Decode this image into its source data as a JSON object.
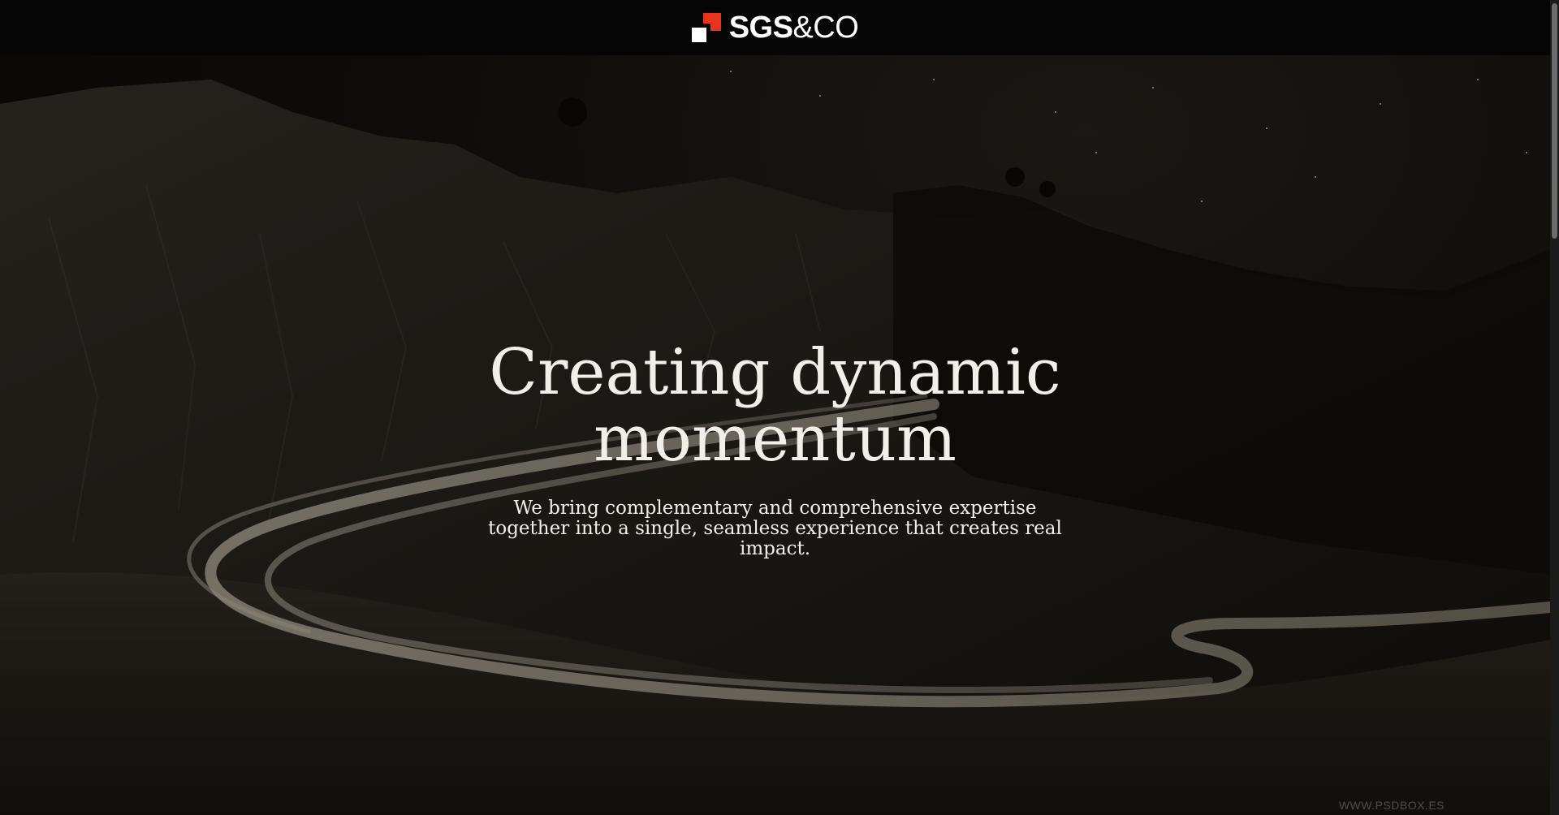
{
  "header": {
    "logo": {
      "brand_bold": "SGS",
      "brand_light": "&CO"
    }
  },
  "hero": {
    "title": "Creating dynamic momentum",
    "subtitle": "We bring complementary and comprehensive expertise together into a single, seamless experience that creates real impact."
  },
  "watermark": "WWW.PSDBOX.ES",
  "colors": {
    "brand_red": "#e8341c",
    "header_bg": "#050505",
    "text": "#f2efe9"
  }
}
